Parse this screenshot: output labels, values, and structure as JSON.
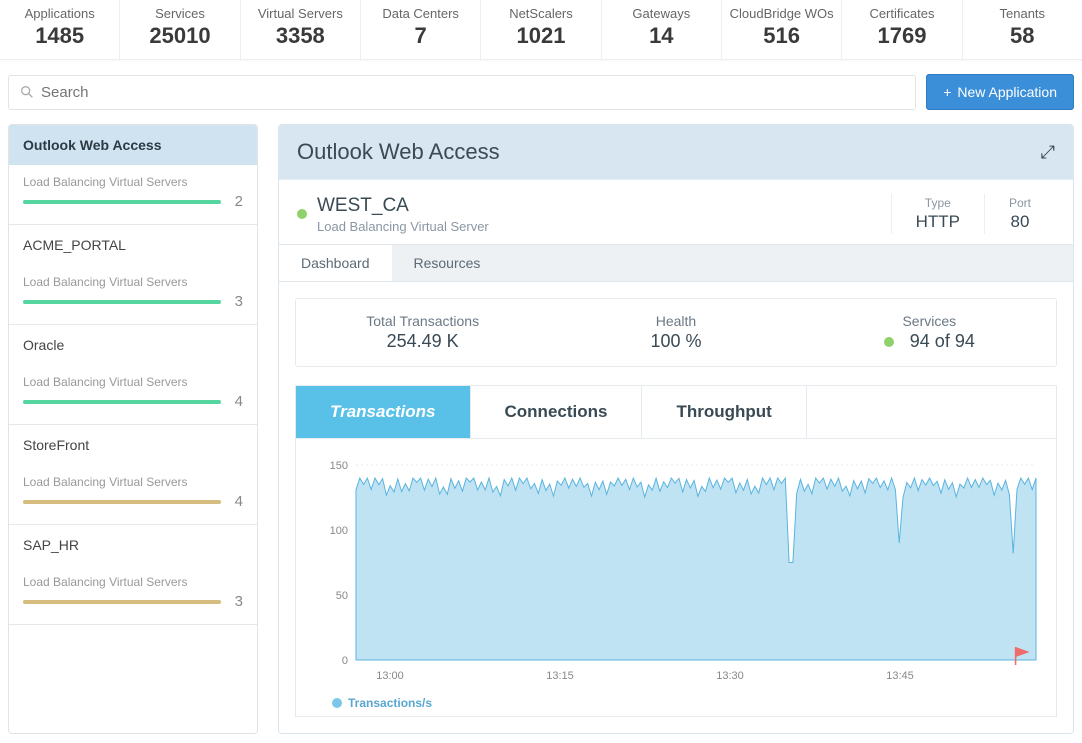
{
  "stats": [
    {
      "label": "Applications",
      "value": "1485"
    },
    {
      "label": "Services",
      "value": "25010"
    },
    {
      "label": "Virtual Servers",
      "value": "3358"
    },
    {
      "label": "Data Centers",
      "value": "7"
    },
    {
      "label": "NetScalers",
      "value": "1021"
    },
    {
      "label": "Gateways",
      "value": "14"
    },
    {
      "label": "CloudBridge WOs",
      "value": "516"
    },
    {
      "label": "Certificates",
      "value": "1769"
    },
    {
      "label": "Tenants",
      "value": "58"
    }
  ],
  "search": {
    "placeholder": "Search"
  },
  "new_app_btn": "New Application",
  "sidebar": {
    "items": [
      {
        "name": "Outlook Web Access",
        "sub": "Load Balancing Virtual Servers",
        "count": "2",
        "color": "green",
        "active": true
      },
      {
        "name": "ACME_PORTAL",
        "sub": "Load Balancing Virtual Servers",
        "count": "3",
        "color": "green"
      },
      {
        "name": "Oracle",
        "sub": "Load Balancing Virtual Servers",
        "count": "4",
        "color": "green"
      },
      {
        "name": "StoreFront",
        "sub": "Load Balancing Virtual Servers",
        "count": "4",
        "color": "tan"
      },
      {
        "name": "SAP_HR",
        "sub": "Load Balancing Virtual Servers",
        "count": "3",
        "color": "tan"
      }
    ]
  },
  "panel": {
    "title": "Outlook Web Access",
    "vs": {
      "name": "WEST_CA",
      "sub": "Load Balancing Virtual Server",
      "type_label": "Type",
      "type": "HTTP",
      "port_label": "Port",
      "port": "80"
    },
    "tabs": {
      "dashboard": "Dashboard",
      "resources": "Resources"
    },
    "summary": {
      "total_label": "Total Transactions",
      "total_value": "254.49 K",
      "health_label": "Health",
      "health_value": "100 %",
      "services_label": "Services",
      "services_value": "94 of 94"
    },
    "graph_tabs": {
      "transactions": "Transactions",
      "connections": "Connections",
      "throughput": "Throughput"
    },
    "legend": "Transactions/s"
  },
  "chart_data": {
    "type": "area",
    "title": "Transactions",
    "xlabel": "",
    "ylabel": "",
    "ylim": [
      0,
      150
    ],
    "yticks": [
      0,
      50,
      100,
      150
    ],
    "xticks": [
      "13:00",
      "13:15",
      "13:30",
      "13:45"
    ],
    "series": [
      {
        "name": "Transactions/s",
        "color": "#7cc7e8",
        "baseline": 135,
        "jitter_low": 125,
        "jitter_high": 140,
        "dips": [
          {
            "x_frac": 0.64,
            "value": 75
          },
          {
            "x_frac": 0.8,
            "value": 90
          },
          {
            "x_frac": 0.965,
            "value": 82
          }
        ]
      }
    ]
  }
}
